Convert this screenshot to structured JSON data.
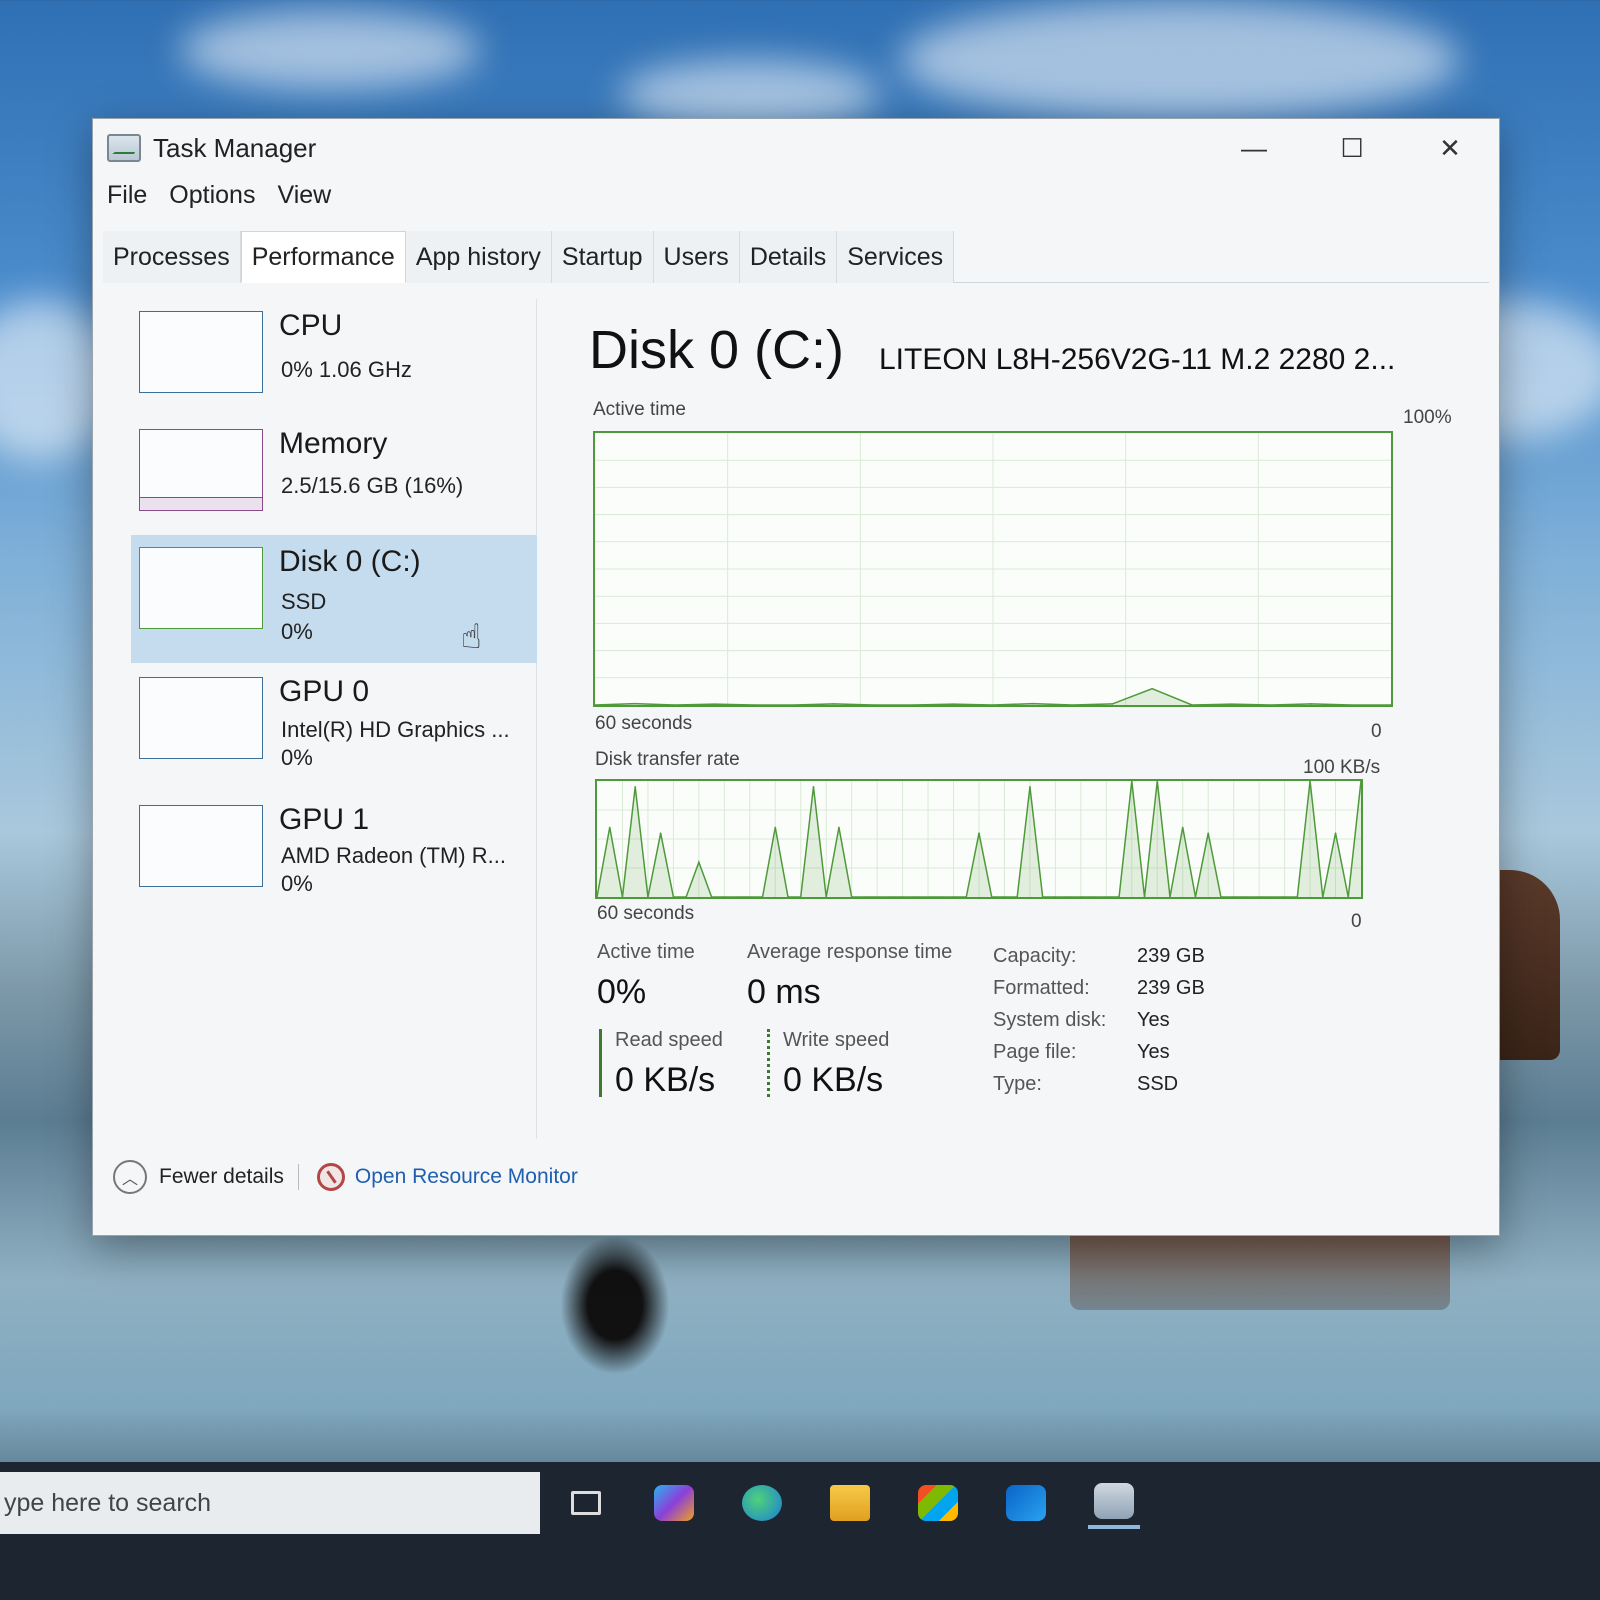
{
  "window": {
    "title": "Task Manager",
    "controls": {
      "minimize": "—",
      "maximize": "☐",
      "close": "✕"
    }
  },
  "menu": [
    "File",
    "Options",
    "View"
  ],
  "tabs": [
    "Processes",
    "Performance",
    "App history",
    "Startup",
    "Users",
    "Details",
    "Services"
  ],
  "active_tab": "Performance",
  "sidebar": {
    "cpu": {
      "name": "CPU",
      "line1": "0%  1.06 GHz"
    },
    "memory": {
      "name": "Memory",
      "line1": "2.5/15.6 GB (16%)"
    },
    "disk": {
      "name": "Disk 0 (C:)",
      "line1": "SSD",
      "line2": "0%"
    },
    "gpu0": {
      "name": "GPU 0",
      "line1": "Intel(R) HD Graphics ...",
      "line2": "0%"
    },
    "gpu1": {
      "name": "GPU 1",
      "line1": "AMD Radeon (TM) R...",
      "line2": "0%"
    }
  },
  "main": {
    "title": "Disk 0 (C:)",
    "model": "LITEON L8H-256V2G-11 M.2 2280 2...",
    "active_chart": {
      "label": "Active time",
      "max": "100%",
      "xlabel": "60 seconds",
      "min": "0"
    },
    "transfer_chart": {
      "label": "Disk transfer rate",
      "max": "100 KB/s",
      "xlabel": "60 seconds",
      "min": "0"
    },
    "stats": {
      "active_time_label": "Active time",
      "active_time_value": "0%",
      "avg_response_label": "Average response time",
      "avg_response_value": "0 ms",
      "read_label": "Read speed",
      "read_value": "0 KB/s",
      "write_label": "Write speed",
      "write_value": "0 KB/s"
    },
    "properties": [
      {
        "key": "Capacity:",
        "value": "239 GB"
      },
      {
        "key": "Formatted:",
        "value": "239 GB"
      },
      {
        "key": "System disk:",
        "value": "Yes"
      },
      {
        "key": "Page file:",
        "value": "Yes"
      },
      {
        "key": "Type:",
        "value": "SSD"
      }
    ]
  },
  "footer": {
    "fewer_details": "Fewer details",
    "resource_monitor": "Open Resource Monitor"
  },
  "taskbar": {
    "search_placeholder": "ype here to search",
    "icons": [
      "task-view-icon",
      "copilot-icon",
      "edge-icon",
      "file-explorer-icon",
      "store-icon",
      "outlook-icon",
      "task-manager-icon"
    ]
  },
  "chart_data": [
    {
      "type": "area",
      "title": "Active time",
      "xlabel": "60 seconds",
      "ylim": [
        0,
        100
      ],
      "x": [
        0,
        3,
        6,
        9,
        12,
        15,
        18,
        21,
        24,
        27,
        30,
        33,
        36,
        39,
        42,
        45,
        48,
        51,
        54,
        57,
        60
      ],
      "values": [
        0,
        0.5,
        0,
        0.3,
        0,
        0,
        0.4,
        0,
        0,
        0.3,
        0,
        0.5,
        0,
        0.4,
        6,
        0,
        0.3,
        0,
        0.4,
        0,
        0
      ]
    },
    {
      "type": "line",
      "title": "Disk transfer rate",
      "xlabel": "60 seconds",
      "ylim": [
        0,
        100
      ],
      "x": [
        0,
        1,
        2,
        3,
        4,
        5,
        6,
        7,
        8,
        9,
        10,
        11,
        12,
        13,
        14,
        15,
        16,
        17,
        18,
        19,
        20,
        21,
        22,
        23,
        24,
        25,
        26,
        27,
        28,
        29,
        30,
        31,
        32,
        33,
        34,
        35,
        36,
        37,
        38,
        39,
        40,
        41,
        42,
        43,
        44,
        45,
        46,
        47,
        48,
        49,
        50,
        51,
        52,
        53,
        54,
        55,
        56,
        57,
        58,
        59,
        60
      ],
      "values": [
        0,
        60,
        0,
        95,
        0,
        55,
        0,
        0,
        30,
        0,
        0,
        0,
        0,
        0,
        60,
        0,
        0,
        95,
        0,
        60,
        0,
        0,
        0,
        0,
        0,
        0,
        0,
        0,
        0,
        0,
        55,
        0,
        0,
        0,
        95,
        0,
        0,
        0,
        0,
        0,
        0,
        0,
        100,
        0,
        100,
        0,
        60,
        0,
        55,
        0,
        0,
        0,
        0,
        0,
        0,
        0,
        100,
        0,
        55,
        0,
        100
      ]
    }
  ]
}
